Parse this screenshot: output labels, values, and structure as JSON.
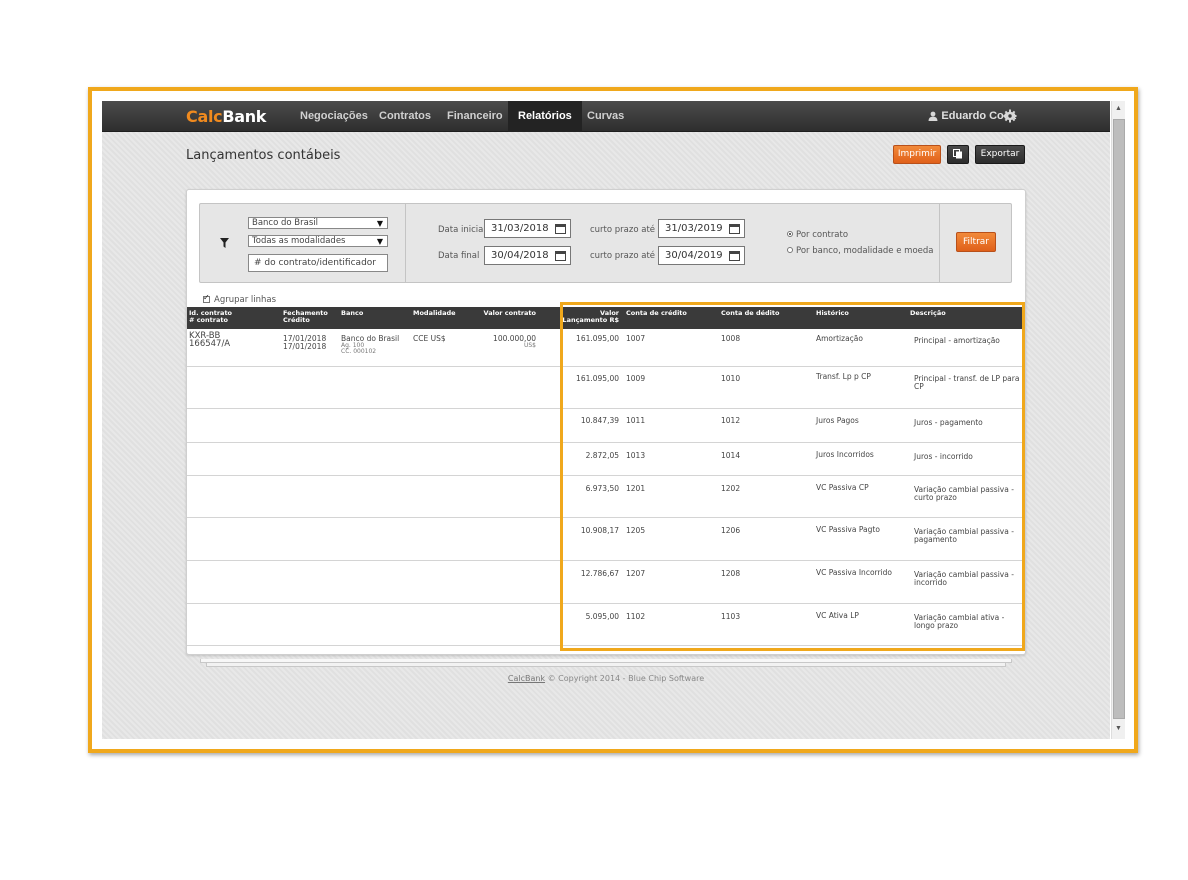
{
  "brand": {
    "calc": "Calc",
    "bank": "Bank"
  },
  "nav": {
    "items": [
      {
        "label": "Negociações"
      },
      {
        "label": "Contratos"
      },
      {
        "label": "Financeiro"
      },
      {
        "label": "Relatórios"
      },
      {
        "label": "Curvas"
      }
    ],
    "active": "Relatórios",
    "user": "Eduardo Coca"
  },
  "page": {
    "title": "Lançamentos contábeis",
    "print_label": "Imprimir",
    "export_label": "Exportar"
  },
  "filters": {
    "bank": "Banco do Brasil",
    "modality": "Todas as modalidades",
    "contract_placeholder": "# do contrato/identificador",
    "start_label": "Data inicial",
    "start_value": "31/03/2018",
    "end_label": "Data final",
    "end_value": "30/04/2018",
    "short_term_label_1": "curto prazo até",
    "short_term_value_1": "31/03/2019",
    "short_term_label_2": "curto prazo até",
    "short_term_value_2": "30/04/2019",
    "radio_1": "Por contrato",
    "radio_2": "Por banco, modalidade e moeda",
    "filter_button": "Filtrar"
  },
  "group_rows_label": "Agrupar linhas",
  "table": {
    "headers": {
      "id_1": "Id. contrato",
      "id_2": "# contrato",
      "close_1": "Fechamento",
      "close_2": "Crédito",
      "bank": "Banco",
      "modality": "Modalidade",
      "contract_value": "Valor contrato",
      "entry_value_1": "Valor",
      "entry_value_2": "Lançamento R$",
      "credit_account": "Conta de crédito",
      "debit_account": "Conta de dédito",
      "history": "Histórico",
      "description": "Descrição"
    },
    "contract": {
      "id": "KXR-BB",
      "number": "166547/A",
      "close_date": "17/01/2018",
      "credit_date": "17/01/2018",
      "bank": "Banco do Brasil",
      "agency": "Ag. 100",
      "account": "CC. 000102",
      "modality": "CCE US$",
      "value": "100.000,00",
      "currency": "US$"
    },
    "entries": [
      {
        "value": "161.095,00",
        "credit": "1007",
        "debit": "1008",
        "history": "Amortização",
        "description": "Principal - amortização"
      },
      {
        "value": "161.095,00",
        "credit": "1009",
        "debit": "1010",
        "history": "Transf. Lp p CP",
        "description": "Principal - transf. de LP para CP"
      },
      {
        "value": "10.847,39",
        "credit": "1011",
        "debit": "1012",
        "history": "Juros Pagos",
        "description": "Juros - pagamento"
      },
      {
        "value": "2.872,05",
        "credit": "1013",
        "debit": "1014",
        "history": "Juros Incorridos",
        "description": "Juros - incorrido"
      },
      {
        "value": "6.973,50",
        "credit": "1201",
        "debit": "1202",
        "history": "VC Passiva CP",
        "description": "Variação cambial passiva - curto prazo"
      },
      {
        "value": "10.908,17",
        "credit": "1205",
        "debit": "1206",
        "history": "VC Passiva Pagto",
        "description": "Variação cambial passiva - pagamento"
      },
      {
        "value": "12.786,67",
        "credit": "1207",
        "debit": "1208",
        "history": "VC Passiva Incorrido",
        "description": "Variação cambial passiva - incorrido"
      },
      {
        "value": "5.095,00",
        "credit": "1102",
        "debit": "1103",
        "history": "VC Ativa LP",
        "description": "Variação cambial ativa - longo prazo"
      }
    ]
  },
  "footer": {
    "link": "CalcBank",
    "text": " © Copyright 2014 - Blue Chip Software"
  },
  "colors": {
    "accent": "#f08a1e",
    "highlight": "#f0a81c",
    "navbar": "#3a3a3a"
  }
}
